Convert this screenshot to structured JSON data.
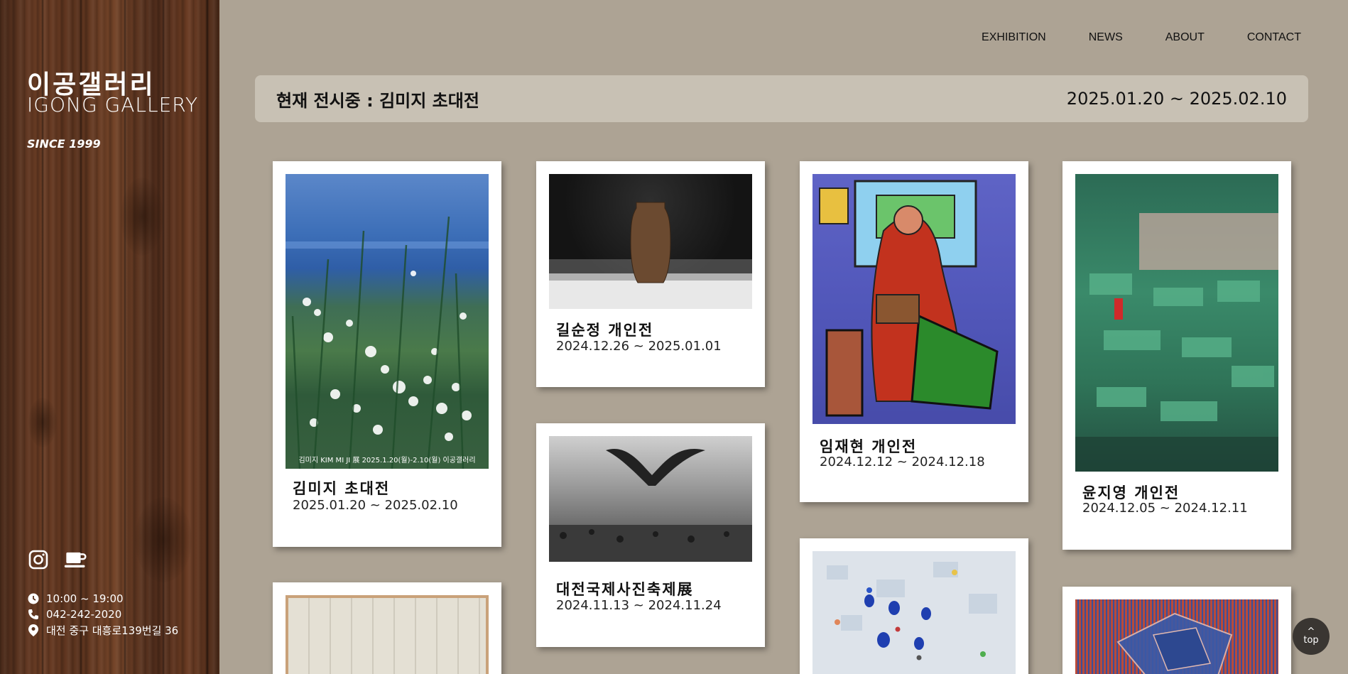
{
  "sidebar": {
    "brand_ko": "이공갤러리",
    "brand_en": "IGONG GALLERY",
    "since": "SINCE 1999",
    "social_icons": [
      "instagram-icon",
      "coffee-cup-icon"
    ],
    "hours": "10:00 ~ 19:00",
    "phone": "042-242-2020",
    "address": "대전 중구 대흥로139번길 36"
  },
  "nav": {
    "items": [
      "EXHIBITION",
      "NEWS",
      "ABOUT",
      "CONTACT"
    ]
  },
  "banner": {
    "title": "현재 전시중 : 김미지 초대전",
    "date": "2025.01.20 ~ 2025.02.10"
  },
  "exhibitions": [
    {
      "title": "김미지 초대전",
      "date": "2025.01.20 ~ 2025.02.10",
      "caption": "김미지 KIM MI JI 展 2025.1.20(월)-2.10(월) 이공갤러리"
    },
    {
      "title": "길순정 개인전",
      "date": "2024.12.26 ~ 2025.01.01"
    },
    {
      "title": "임재현 개인전",
      "date": "2024.12.12 ~ 2024.12.18"
    },
    {
      "title": "윤지영 개인전",
      "date": "2024.12.05 ~ 2024.12.11"
    },
    {
      "title": "대전국제사진축제展",
      "date": "2024.11.13 ~ 2024.11.24"
    }
  ],
  "top_button": {
    "label": "top"
  },
  "colors": {
    "page_bg": "#ada394",
    "banner_bg": "#c8c1b4",
    "card_bg": "#ffffff"
  }
}
